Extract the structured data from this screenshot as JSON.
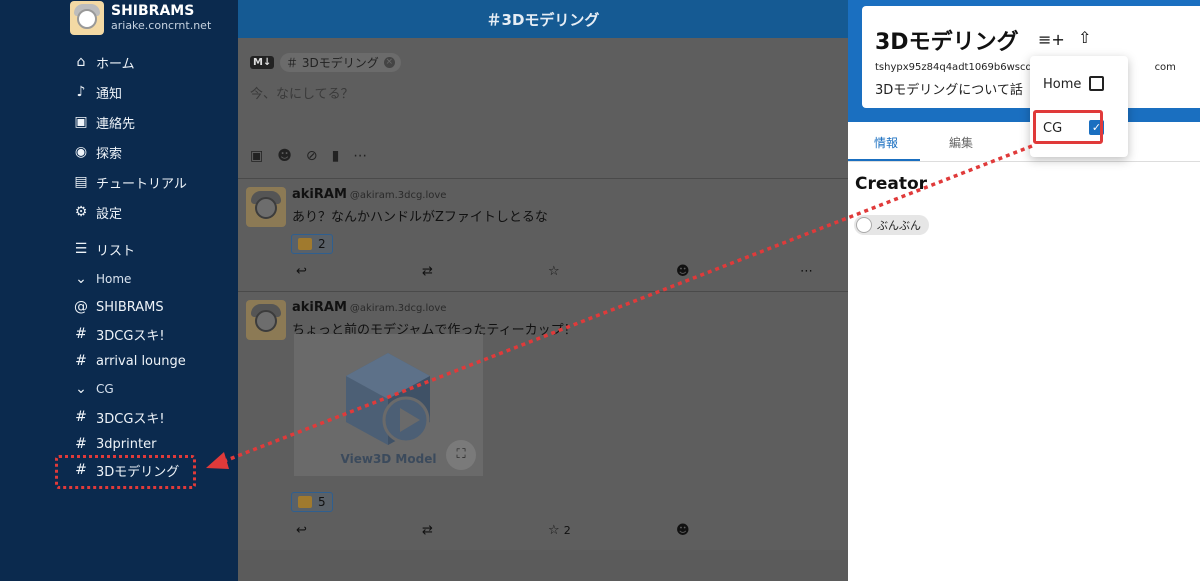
{
  "sidebar": {
    "profile": {
      "name": "SHIBRAMS",
      "host": "ariake.concrnt.net"
    },
    "items": [
      {
        "label": "ホーム",
        "icon": "home-icon",
        "glyph": "⌂"
      },
      {
        "label": "通知",
        "icon": "bell-icon",
        "glyph": "🔔"
      },
      {
        "label": "連絡先",
        "icon": "contacts-icon",
        "glyph": "▣"
      },
      {
        "label": "探索",
        "icon": "compass-icon",
        "glyph": "◉"
      },
      {
        "label": "チュートリアル",
        "icon": "book-icon",
        "glyph": "▤"
      },
      {
        "label": "設定",
        "icon": "gear-icon",
        "glyph": "⚙"
      },
      {
        "label": "リスト",
        "icon": "list-icon",
        "glyph": "☰"
      }
    ],
    "groups": [
      {
        "label": "Home",
        "children": [
          {
            "label": "SHIBRAMS",
            "glyph": "@"
          },
          {
            "label": "3DCGスキ!",
            "glyph": "#"
          },
          {
            "label": "arrival lounge",
            "glyph": "#"
          }
        ]
      },
      {
        "label": "CG",
        "children": [
          {
            "label": "3DCGスキ!",
            "glyph": "#"
          },
          {
            "label": "3dprinter",
            "glyph": "#"
          },
          {
            "label": "3Dモデリング",
            "glyph": "#"
          }
        ]
      }
    ]
  },
  "timeline": {
    "header": "＃3Dモデリング",
    "composer": {
      "md_badge": "M↓",
      "chip": "3Dモデリング",
      "placeholder": "今、なにしてる？"
    },
    "posts": [
      {
        "author": "akiRAM",
        "handle": "@akiram.3dcg.love",
        "text": "あり？なんかハンドルがZファイトしとるな",
        "reaction_count": "2",
        "like_count": ""
      },
      {
        "author": "akiRAM",
        "handle": "@akiram.3dcg.love",
        "text": "ちょっと前のモデジャムで作ったティーカップ！",
        "media_caption": "View3D Model",
        "reaction_count": "5",
        "like_count": "2"
      }
    ]
  },
  "panel": {
    "title": "3Dモデリング",
    "id_text": "tshypx95z84q4adt1069b6wscq0g",
    "id_suffix": "com",
    "description": "3Dモデリングについて話",
    "tabs": [
      "情報",
      "編集"
    ],
    "section_title": "Creator",
    "creator": "ぶんぶん"
  },
  "menu": {
    "items": [
      {
        "label": "Home",
        "checked": false
      },
      {
        "label": "CG",
        "checked": true
      }
    ]
  },
  "colors": {
    "sidebar_bg": "#0b2a4e",
    "accent": "#1a6fc0",
    "annotation": "#e03a3a"
  }
}
